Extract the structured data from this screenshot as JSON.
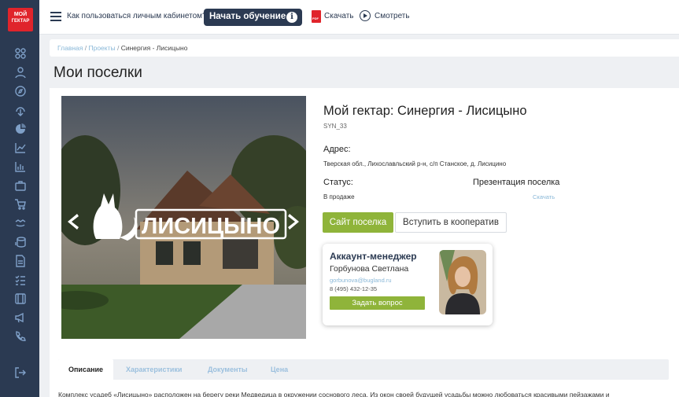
{
  "logo": {
    "line1": "МОЙ",
    "line2": "ГЕКТАР"
  },
  "sidebar": {
    "icons": [
      "grid-icon",
      "user-icon",
      "compass-icon",
      "globe-icon",
      "chart-pie-icon",
      "line-chart-icon",
      "bar-chart-icon",
      "briefcase-icon",
      "cart-icon",
      "handshake-icon",
      "coins-icon",
      "document-icon",
      "checklist-icon",
      "book-icon",
      "megaphone-icon",
      "phone-icon",
      "logout-icon"
    ]
  },
  "topbar": {
    "help_text": "Как пользоваться личным кабинетом?",
    "learn_button": "Начать обучение",
    "download_label": "Скачать",
    "watch_label": "Смотреть"
  },
  "breadcrumb": {
    "home": "Главная",
    "projects": "Проекты",
    "current": "Синергия - Лисицыно",
    "sep": "/"
  },
  "page_title": "Мои поселки",
  "project": {
    "title": "Мой гектар: Синергия - Лисицыно",
    "code": "SYN_33",
    "address_label": "Адрес:",
    "address": "Тверская обл., Лихославльский р-н, с/п Станское, д. Лисицино",
    "status_label": "Статус:",
    "status": "В продаже",
    "presentation_label": "Презентация поселка",
    "presentation_download": "Скачать",
    "logo_text": "ЛИСИЦЫНО",
    "site_button": "Сайт поселка",
    "coop_button": "Вступить в кооператив"
  },
  "manager": {
    "role": "Аккаунт-менеджер",
    "name": "Горбунова Светлана",
    "email": "gorbunova@bugland.ru",
    "phone": "8 (495) 432-12-35",
    "ask_button": "Задать вопрос"
  },
  "tabs": [
    {
      "label": "Описание",
      "active": true
    },
    {
      "label": "Характеристики",
      "active": false
    },
    {
      "label": "Документы",
      "active": false
    },
    {
      "label": "Цена",
      "active": false
    }
  ],
  "description": "Комплекс усадеб «Лисицыно» расположен на берегу реки Медведица в окружении соснового леса. Из окон своей будущей усадьбы можно любоваться красивыми пейзажами и",
  "colors": {
    "accent_green": "#8fb43a",
    "navy": "#2b3a52",
    "link_blue": "#8ab8d8",
    "logo_red": "#e0242b"
  }
}
